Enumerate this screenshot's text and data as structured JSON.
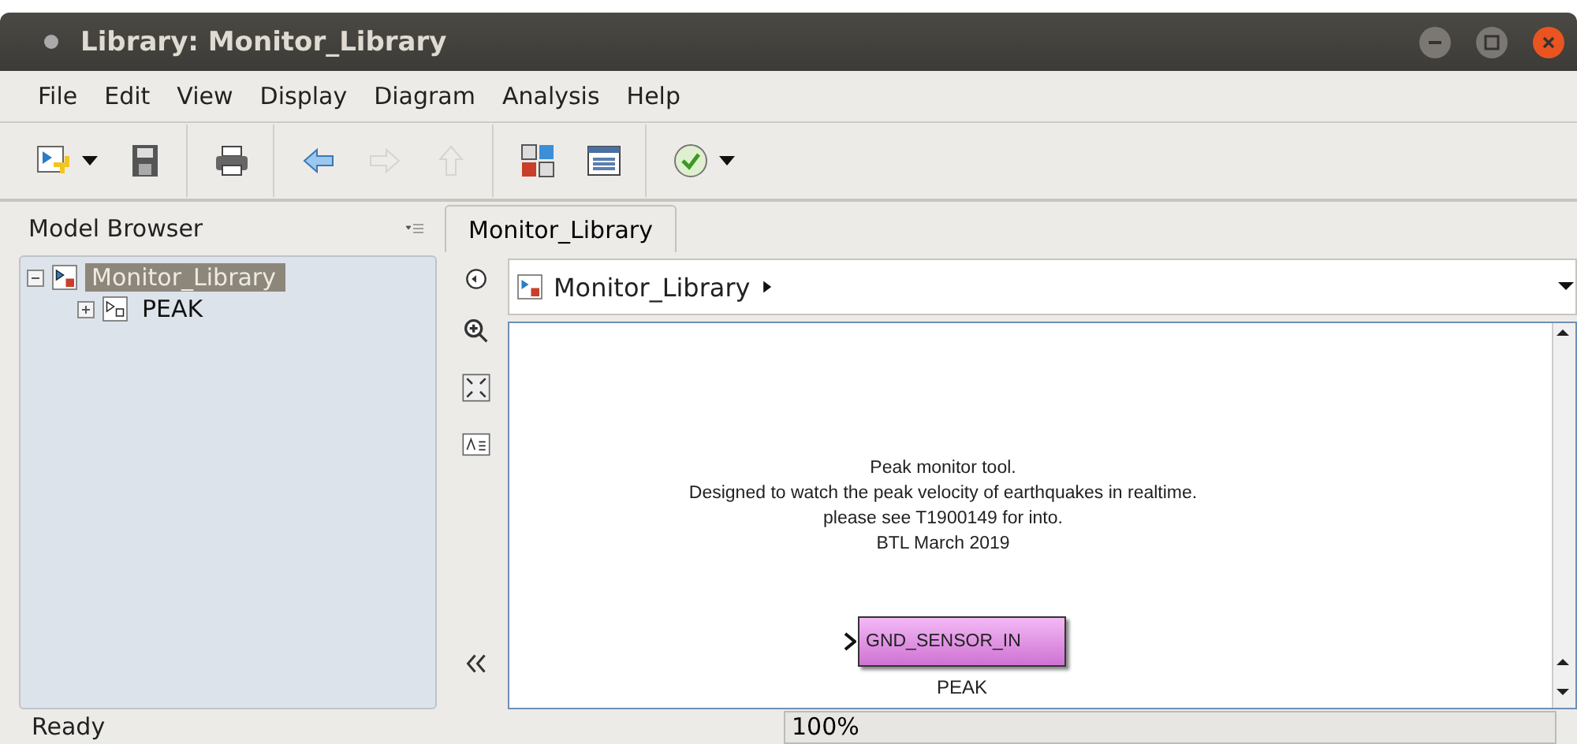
{
  "window": {
    "title": "Library: Monitor_Library"
  },
  "menu": [
    "File",
    "Edit",
    "View",
    "Display",
    "Diagram",
    "Analysis",
    "Help"
  ],
  "toolbar": [
    {
      "kind": "new"
    },
    {
      "kind": "save"
    },
    {
      "kind": "print"
    },
    {
      "kind": "back",
      "disabled": false
    },
    {
      "kind": "forward",
      "disabled": true
    },
    {
      "kind": "up",
      "disabled": true
    },
    {
      "kind": "library"
    },
    {
      "kind": "explorer"
    },
    {
      "kind": "check"
    }
  ],
  "model_browser": {
    "title": "Model Browser",
    "tree": [
      {
        "label": "Monitor_Library",
        "selected": true,
        "expanded": true,
        "children": [
          {
            "label": "PEAK",
            "selected": false,
            "expanded": false
          }
        ]
      }
    ]
  },
  "tabs": [
    {
      "label": "Monitor_Library",
      "selected": true
    }
  ],
  "breadcrumb": "Monitor_Library",
  "canvas": {
    "annotation": [
      "Peak monitor tool.",
      "Designed to watch the peak velocity of earthquakes in realtime.",
      "please see T1900149 for into.",
      "BTL March 2019"
    ],
    "block": {
      "port": "GND_SENSOR_IN",
      "name": "PEAK"
    }
  },
  "status_bar": {
    "status": "Ready",
    "zoom": "100%"
  }
}
